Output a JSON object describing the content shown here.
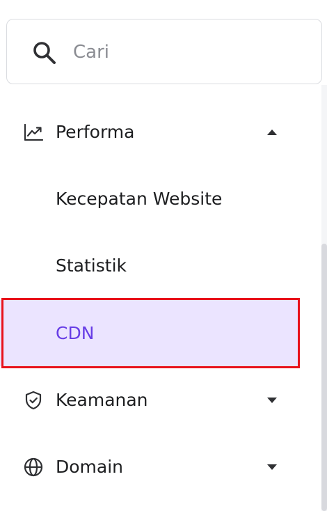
{
  "search": {
    "placeholder": "Cari",
    "value": "",
    "icon": "search-icon"
  },
  "menu": {
    "performa": {
      "label": "Performa",
      "icon": "trending-up-icon",
      "expanded": true,
      "caret": "caret-up-icon",
      "children": [
        {
          "label": "Kecepatan Website"
        },
        {
          "label": "Statistik"
        },
        {
          "label": "CDN",
          "active": true
        }
      ]
    },
    "keamanan": {
      "label": "Keamanan",
      "icon": "shield-check-icon",
      "caret": "caret-down-icon"
    },
    "domain": {
      "label": "Domain",
      "icon": "globe-icon",
      "caret": "caret-down-icon"
    }
  },
  "colors": {
    "active_bg": "#ebe4ff",
    "active_text": "#673de6",
    "highlight_border": "#e8121b"
  }
}
